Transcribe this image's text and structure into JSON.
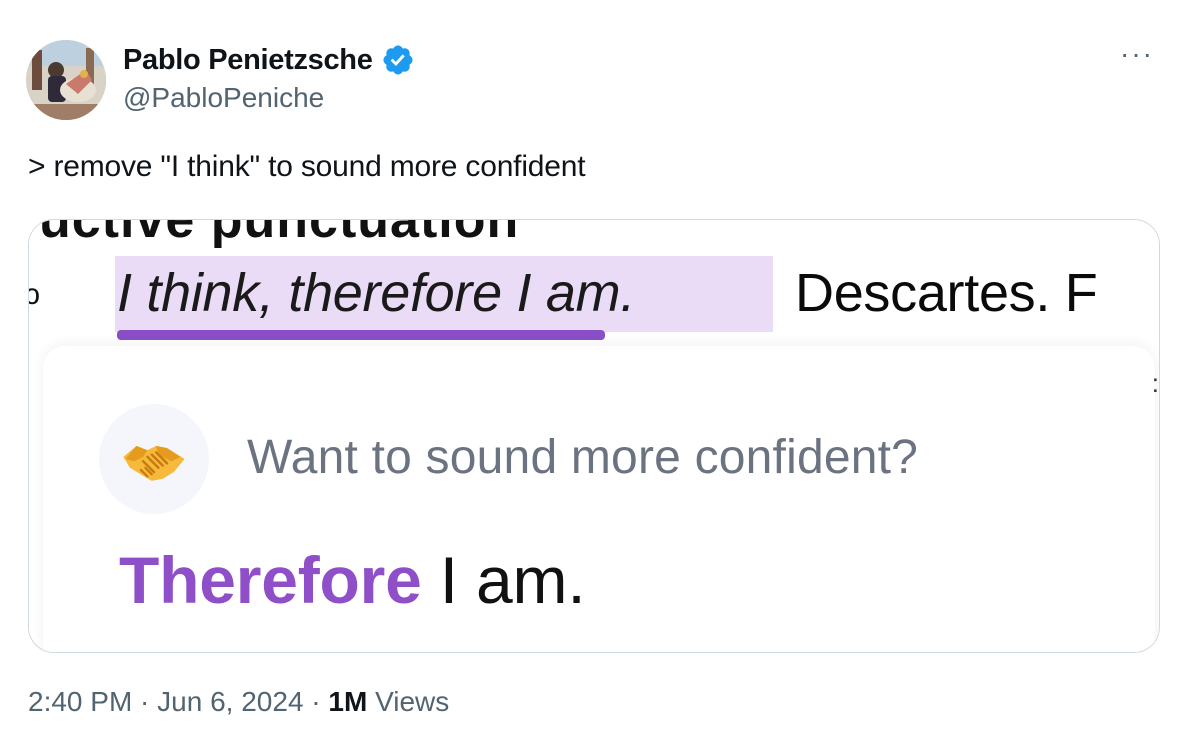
{
  "author": {
    "display_name": "Pablo Penietzsche",
    "handle": "@PabloPeniche",
    "verified": true,
    "verified_color": "#1d9bf0"
  },
  "more_label": "···",
  "tweet_text": "> remove \"I think\" to sound more confident",
  "media": {
    "cutoff_text": "uctive punctuation",
    "highlighted_quote": "I think, therefore I am.",
    "quote_rest": "Descartes. F",
    "highlight_color": "#eadcf7",
    "underline_color": "#8a4fc7",
    "card": {
      "icon": "handshake-icon",
      "prompt": "Want to sound more confident?",
      "suggestion_keyword": "Therefore",
      "suggestion_rest": " I am.",
      "keyword_color": "#8e4fc8"
    }
  },
  "meta": {
    "time": "2:40 PM",
    "separator": " · ",
    "date": "Jun 6, 2024",
    "views_count": "1M",
    "views_label": " Views"
  }
}
